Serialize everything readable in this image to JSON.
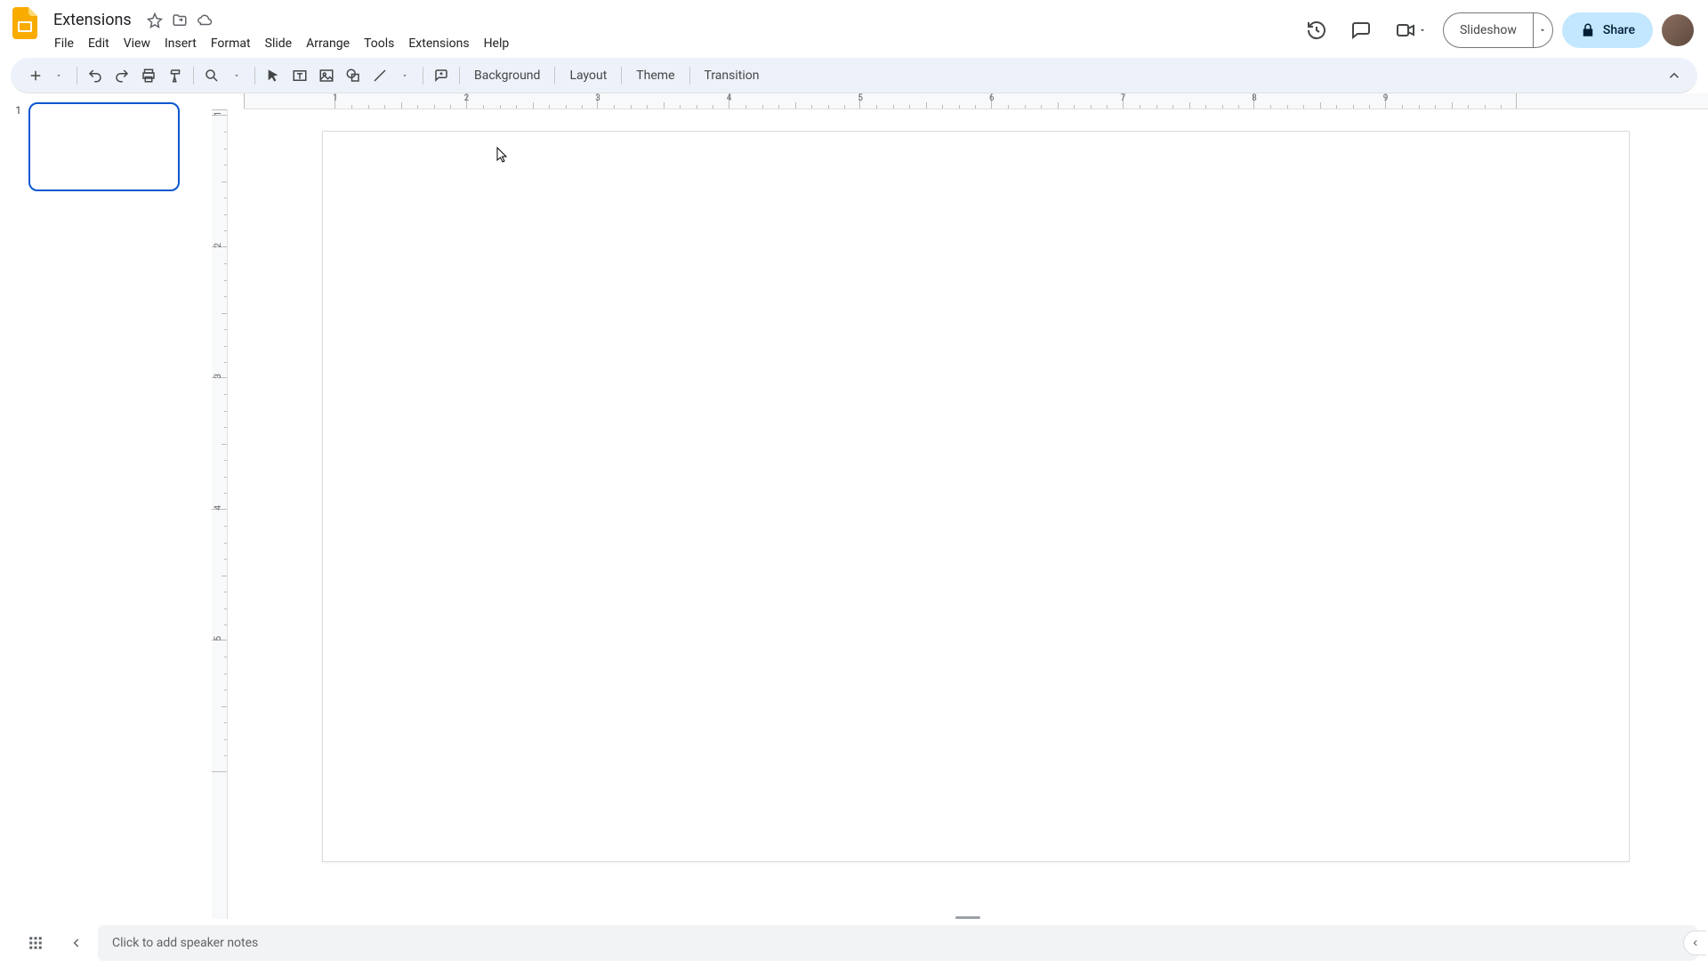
{
  "doc": {
    "title": "Extensions"
  },
  "menubar": [
    "File",
    "Edit",
    "View",
    "Insert",
    "Format",
    "Slide",
    "Arrange",
    "Tools",
    "Extensions",
    "Help"
  ],
  "header_buttons": {
    "slideshow": "Slideshow",
    "share": "Share"
  },
  "toolbar_text": {
    "background": "Background",
    "layout": "Layout",
    "theme": "Theme",
    "transition": "Transition"
  },
  "slides": [
    {
      "number": "1"
    }
  ],
  "ruler_h": [
    "",
    "1",
    "2",
    "3",
    "4",
    "5",
    "6",
    "7",
    "8",
    "9",
    ""
  ],
  "ruler_v": [
    "",
    "1",
    "2",
    "3",
    "4",
    "5",
    ""
  ],
  "speaker_notes_placeholder": "Click to add speaker notes"
}
